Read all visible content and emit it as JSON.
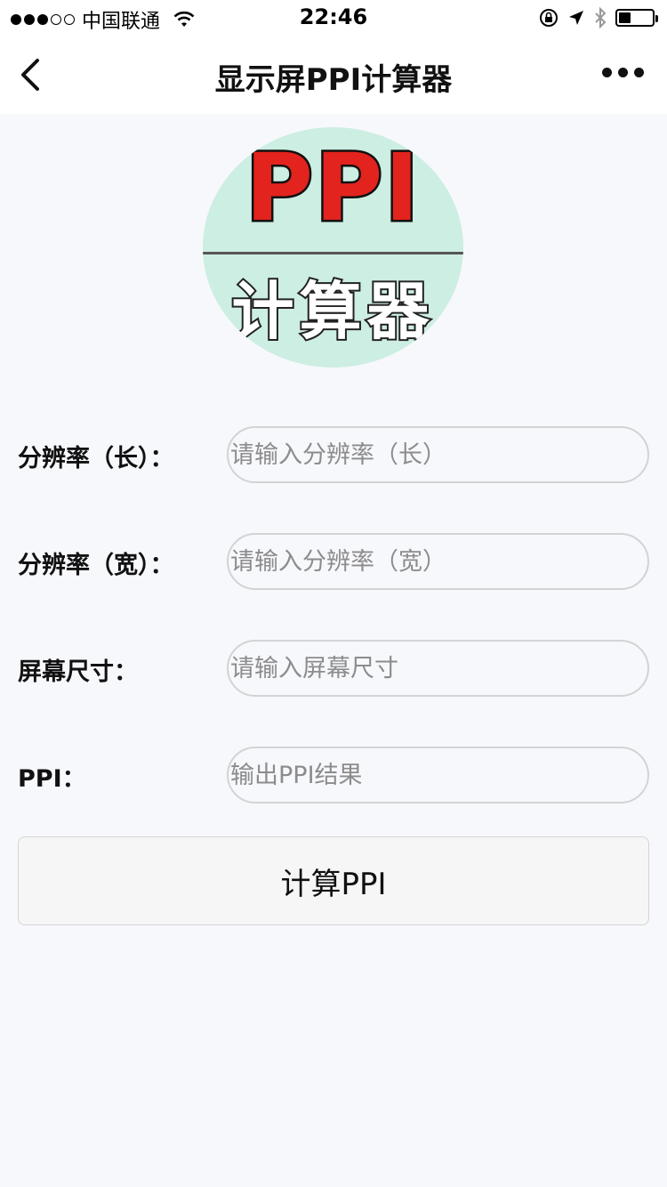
{
  "status_bar": {
    "carrier": "中国联通",
    "time": "22:46",
    "battery_level": 0.35
  },
  "nav": {
    "title": "显示屏PPI计算器",
    "back_icon": "chevron-left-icon",
    "more_icon": "more-dots-icon"
  },
  "logo": {
    "top_text": "PPI",
    "bottom_text": "计算器",
    "colors": {
      "circle": "#cdeee2",
      "ppi": "#e3231d"
    }
  },
  "form": {
    "fields": [
      {
        "label": "分辨率（长）：",
        "placeholder": "请输入分辨率（长）",
        "value": ""
      },
      {
        "label": "分辨率（宽）：",
        "placeholder": "请输入分辨率（宽）",
        "value": ""
      },
      {
        "label": "屏幕尺寸：",
        "placeholder": "请输入屏幕尺寸",
        "value": ""
      },
      {
        "label": "PPI：",
        "placeholder": "输出PPI结果",
        "value": ""
      }
    ],
    "submit_label": "计算PPI"
  }
}
